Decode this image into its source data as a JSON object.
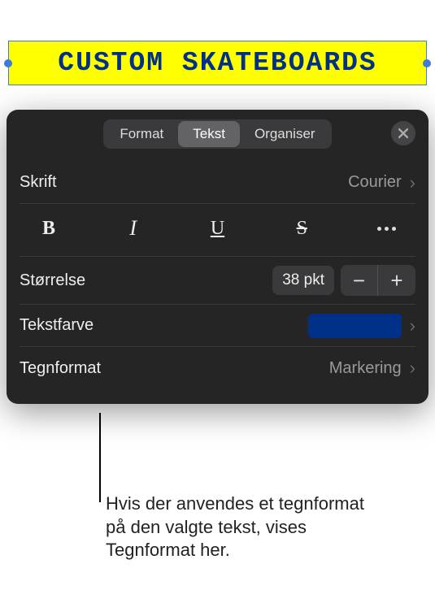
{
  "canvas": {
    "sample_text": "CUSTOM SKATEBOARDS"
  },
  "panel": {
    "tabs": [
      {
        "label": "Format"
      },
      {
        "label": "Tekst"
      },
      {
        "label": "Organiser"
      }
    ],
    "active_tab_index": 1,
    "font": {
      "label": "Skrift",
      "value": "Courier"
    },
    "style_buttons": {
      "bold": "B",
      "italic": "I",
      "underline": "U",
      "strike": "S"
    },
    "size": {
      "label": "Størrelse",
      "value": "38 pkt"
    },
    "text_color": {
      "label": "Tekstfarve",
      "value_hex": "#003087"
    },
    "char_format": {
      "label": "Tegnformat",
      "value": "Markering"
    }
  },
  "callout": {
    "text": "Hvis der anvendes et tegnformat på den valgte tekst, vises Tegnformat her."
  }
}
